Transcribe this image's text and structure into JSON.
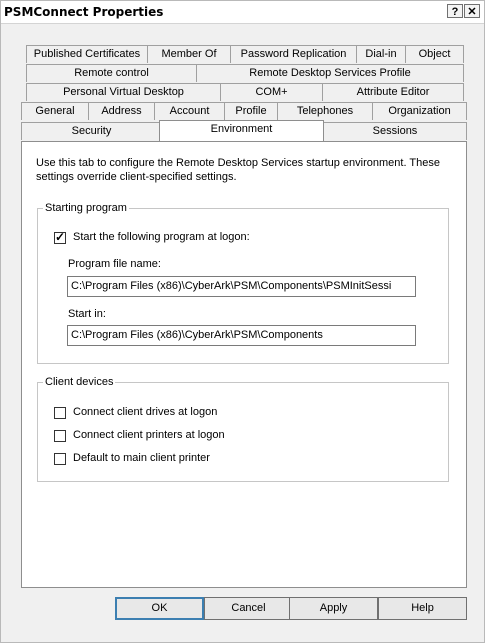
{
  "window": {
    "title": "PSMConnect Properties",
    "help_glyph": "?",
    "close_glyph": "✕"
  },
  "tabs": {
    "row1": [
      "Published Certificates",
      "Member Of",
      "Password Replication",
      "Dial-in",
      "Object"
    ],
    "row2": [
      "Remote control",
      "Remote Desktop Services Profile"
    ],
    "row3": [
      "Personal Virtual Desktop",
      "COM+",
      "Attribute Editor"
    ],
    "row4": [
      "General",
      "Address",
      "Account",
      "Profile",
      "Telephones",
      "Organization"
    ],
    "row5": [
      "Security",
      "Environment",
      "Sessions"
    ],
    "selected": "Environment"
  },
  "content": {
    "description": "Use this tab to configure the Remote Desktop Services startup environment. These settings override client-specified settings.",
    "starting_program": {
      "legend": "Starting program",
      "start_checkbox": {
        "label": "Start the following program at logon:",
        "checked": true
      },
      "program_label": "Program file name:",
      "program_value": "C:\\Program Files (x86)\\CyberArk\\PSM\\Components\\PSMInitSessi",
      "startin_label": "Start in:",
      "startin_value": "C:\\Program Files (x86)\\CyberArk\\PSM\\Components"
    },
    "client_devices": {
      "legend": "Client devices",
      "items": [
        {
          "label": "Connect client drives at logon",
          "checked": false
        },
        {
          "label": "Connect client printers at logon",
          "checked": false
        },
        {
          "label": "Default to main client printer",
          "checked": false
        }
      ]
    }
  },
  "buttons": {
    "ok": "OK",
    "cancel": "Cancel",
    "apply": "Apply",
    "help": "Help"
  }
}
